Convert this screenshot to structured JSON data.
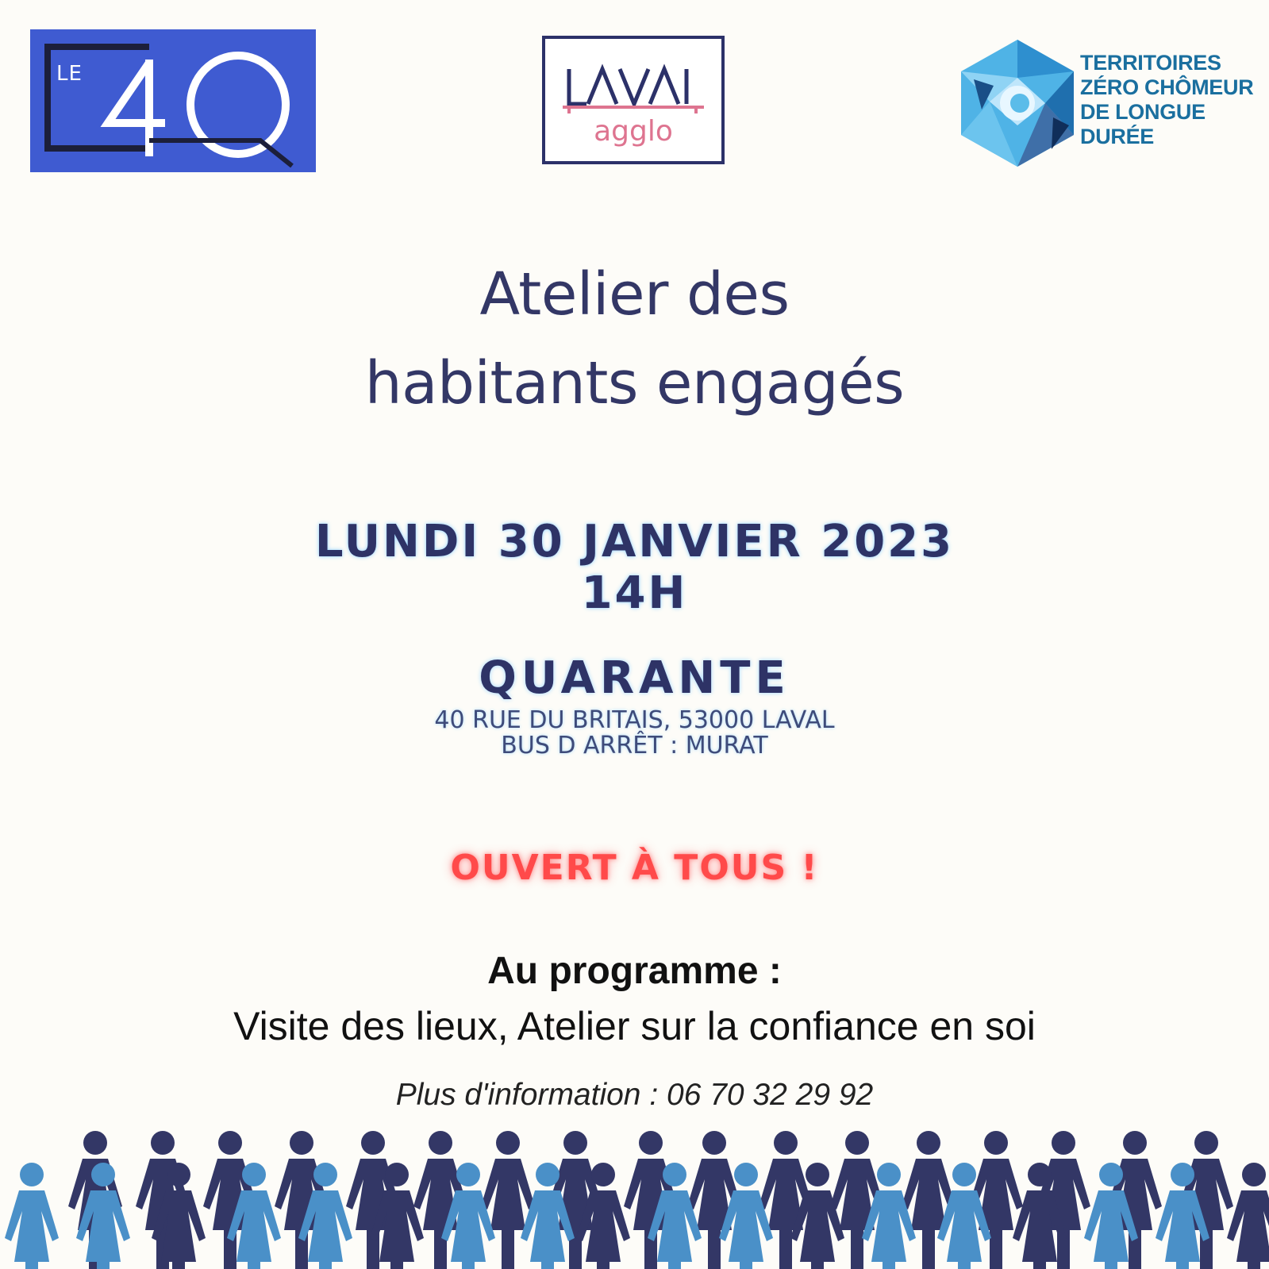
{
  "logos": {
    "le40": {
      "small_text": "LE",
      "big_text": "40"
    },
    "laval": {
      "main": "LAVAL",
      "sub": "agglo"
    },
    "tzcld": {
      "lines": [
        "TERRITOIRES",
        "ZÉRO CHÔMEUR",
        "DE LONGUE",
        "DURÉE"
      ]
    }
  },
  "title": {
    "line1": "Atelier des",
    "line2": "habitants engagés"
  },
  "event": {
    "date": "LUNDI 30 JANVIER 2023",
    "time": "14H"
  },
  "venue": {
    "name": "QUARANTE",
    "address_line1": "40 RUE DU BRITAIS, 53000 LAVAL",
    "address_line2": "BUS D ARRÊT : MURAT"
  },
  "open_text": "OUVERT À TOUS !",
  "program": {
    "heading": "Au programme :",
    "details": "Visite des lieux, Atelier sur la confiance en soi"
  },
  "info": "Plus d'information : 06 70 32 29 92",
  "colors": {
    "navy": "#333766",
    "light_blue": "#4a90c8",
    "accent_red": "#ff4a4a",
    "le40_blue": "#3f5bd1",
    "laval_pink": "#de7490"
  }
}
